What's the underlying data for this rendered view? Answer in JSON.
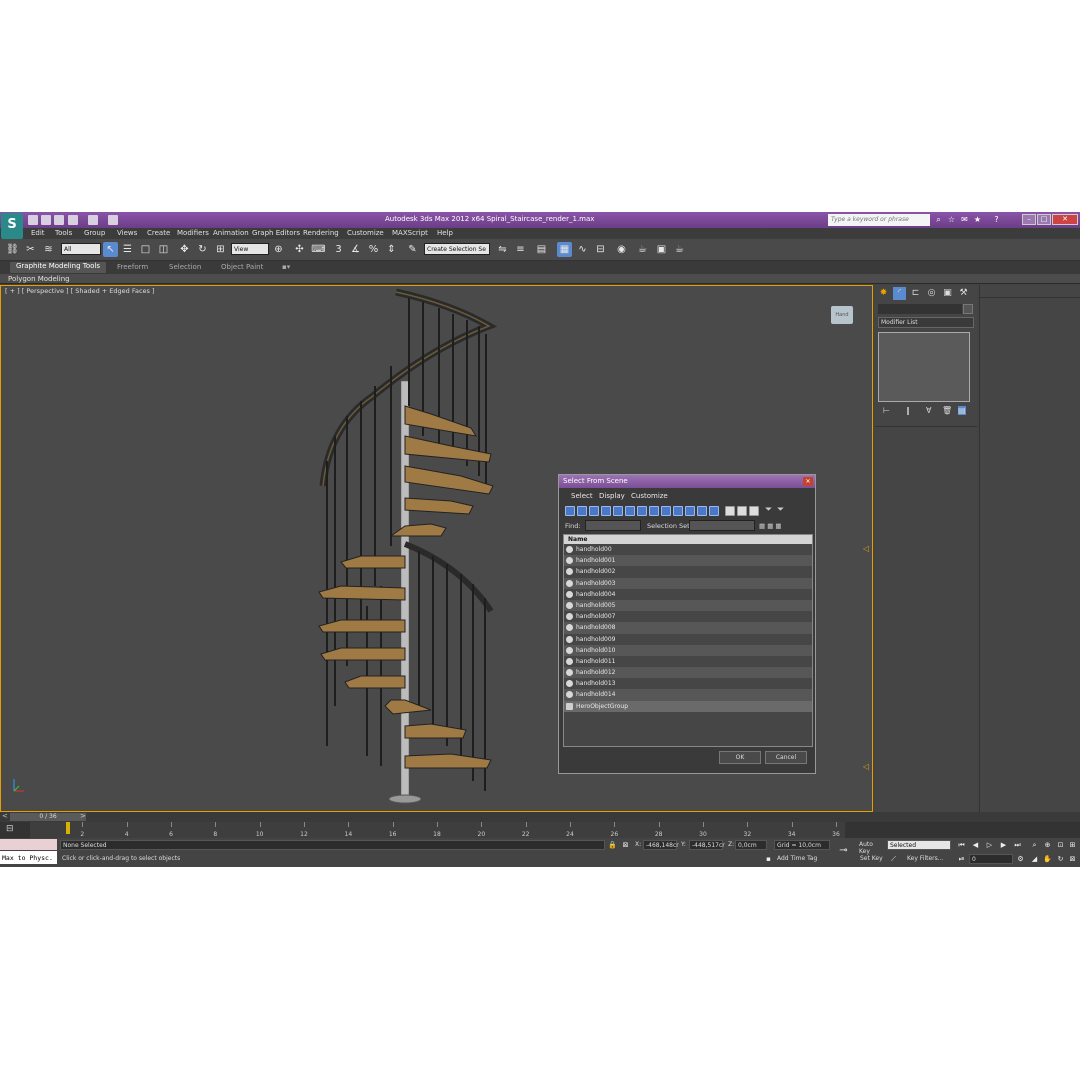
{
  "titlebar": {
    "title": "Autodesk 3ds Max  2012 x64     Spiral_Staircase_render_1.max",
    "search_placeholder": "Type a keyword or phrase"
  },
  "menu": [
    "Edit",
    "Tools",
    "Group",
    "Views",
    "Create",
    "Modifiers",
    "Animation",
    "Graph Editors",
    "Rendering",
    "Customize",
    "MAXScript",
    "Help"
  ],
  "toolbar": {
    "filter_value": "All",
    "ref_coord_value": "View",
    "selection_set_placeholder": "Create Selection Se"
  },
  "ribbon": {
    "tabs": [
      "Graphite Modeling Tools",
      "Freeform",
      "Selection",
      "Object Paint"
    ],
    "sub_label": "Polygon Modeling"
  },
  "viewport": {
    "label": "[ + ] [ Perspective ] [ Shaded + Edged Faces ]",
    "viewcube_label": "Hand"
  },
  "command_panel": {
    "modifier_list": "Modifier List"
  },
  "dialog": {
    "title": "Select From Scene",
    "menu": [
      "Select",
      "Display",
      "Customize"
    ],
    "find_label": "Find:",
    "selection_set_label": "Selection Set:",
    "column_name": "Name",
    "rows": [
      "handhold00",
      "handhold001",
      "handhold002",
      "handhold003",
      "handhold004",
      "handhold005",
      "handhold007",
      "handhold008",
      "handhold009",
      "handhold010",
      "handhold011",
      "handhold012",
      "handhold013",
      "handhold014",
      "HeroObjectGroup"
    ],
    "ok_label": "OK",
    "cancel_label": "Cancel"
  },
  "timeline": {
    "slider": "0 / 36",
    "ticks": [
      "2",
      "4",
      "6",
      "8",
      "10",
      "12",
      "14",
      "16",
      "18",
      "20",
      "22",
      "24",
      "26",
      "28",
      "30",
      "32",
      "34",
      "36"
    ]
  },
  "status": {
    "selection": "None Selected",
    "prompt": "Click or click-and-drag to select objects",
    "maxscript_text": "Max to Physc.",
    "x_label": "X:",
    "x_value": "-468,148cr",
    "y_label": "Y:",
    "y_value": "-448,517cr",
    "z_label": "Z:",
    "z_value": "0,0cm",
    "grid": "Grid = 10,0cm",
    "add_time_tag": "Add Time Tag",
    "auto_key": "Auto Key",
    "set_key": "Set Key",
    "selected_value": "Selected",
    "key_filters": "Key Filters...",
    "frame_value": "0"
  }
}
